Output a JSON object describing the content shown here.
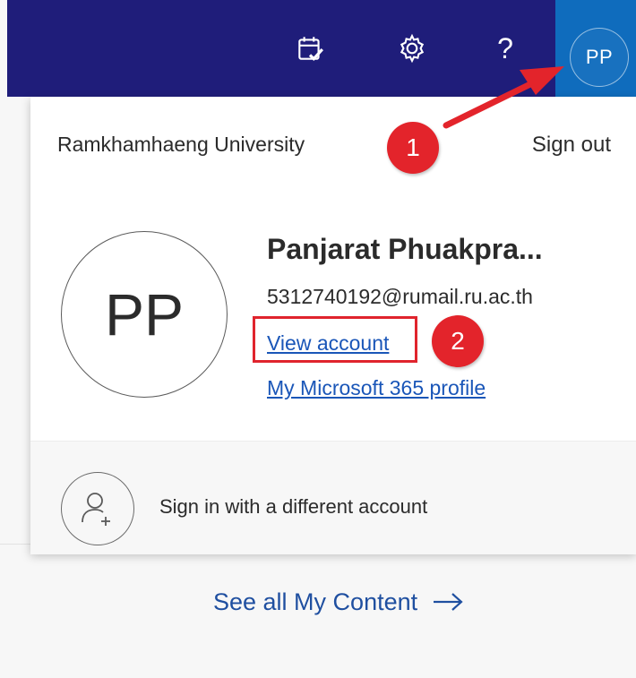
{
  "topbar": {
    "icons": [
      "calendar-check-icon",
      "gear-icon",
      "help-icon"
    ],
    "help_glyph": "?",
    "account_initials": "PP",
    "brand_color": "#1f1d7a",
    "account_tile_color": "#0f6cbd"
  },
  "account_card": {
    "organization": "Ramkhamhaeng University",
    "sign_out_label": "Sign out",
    "avatar_initials": "PP",
    "user_name": "Panjarat Phuakpra...",
    "email": "5312740192@rumail.ru.ac.th",
    "view_account_label": "View account",
    "ms365_profile_label": "My Microsoft 365 profile",
    "sign_in_different_label": "Sign in with a different account"
  },
  "background": {
    "see_all_label": "See all My Content",
    "link_color": "#1f4fa0"
  },
  "annotations": {
    "step1": "1",
    "step2": "2",
    "annotation_color": "#e3242b"
  }
}
